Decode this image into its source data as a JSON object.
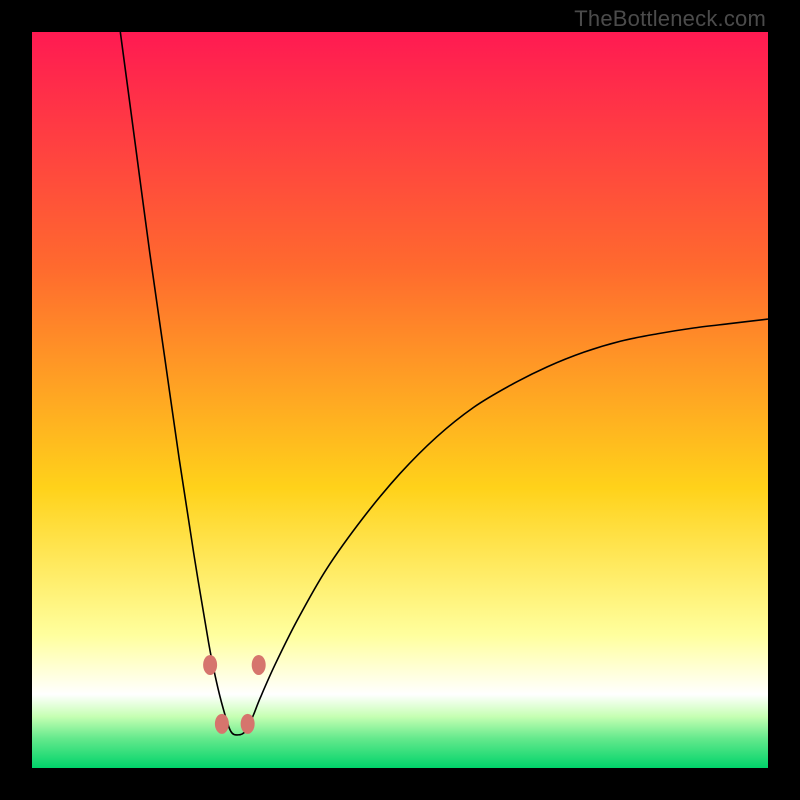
{
  "watermark": "TheBottleneck.com",
  "colors": {
    "top": "#ff1a52",
    "upper": "#ff6a2e",
    "mid": "#ffd21a",
    "pale": "#ffff9e",
    "white": "#ffffff",
    "green1": "#c6ffb3",
    "green2": "#64e98c",
    "green3": "#00d36a",
    "bead": "#d6756d",
    "curve": "#000000",
    "frame": "#000000"
  },
  "chart_data": {
    "type": "line",
    "title": "",
    "xlabel": "",
    "ylabel": "",
    "xlim": [
      0,
      100
    ],
    "ylim": [
      0,
      100
    ],
    "curve_note": "Single V-shaped curve; y approximates absolute deviation from optimum at x≈27, scaled so y≈100 at x≈12 and y≈60 at x=100.",
    "x": [
      12,
      14,
      16,
      18,
      20,
      22,
      24,
      25,
      26,
      27,
      28,
      29,
      30,
      31,
      33,
      36,
      40,
      45,
      50,
      55,
      60,
      65,
      70,
      75,
      80,
      85,
      90,
      95,
      100
    ],
    "y": [
      100,
      85,
      70,
      56,
      42,
      29,
      17,
      12,
      8,
      5,
      4.5,
      5,
      7,
      9.5,
      14,
      20,
      27,
      34,
      40,
      45,
      49,
      52,
      54.5,
      56.5,
      58,
      59,
      59.8,
      60.4,
      61
    ],
    "beads": [
      {
        "x": 24.2,
        "y": 14
      },
      {
        "x": 25.8,
        "y": 6
      },
      {
        "x": 29.3,
        "y": 6
      },
      {
        "x": 30.8,
        "y": 14
      }
    ],
    "good_band_y": [
      0,
      14
    ]
  }
}
